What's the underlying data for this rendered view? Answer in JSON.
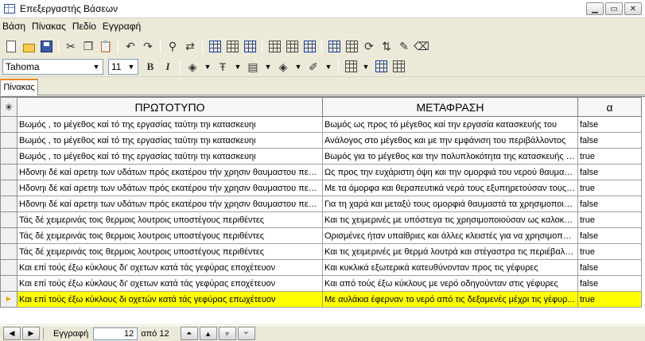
{
  "window": {
    "title": "Επεξεργαστής Βάσεων"
  },
  "menu": [
    "Βάση",
    "Πίνακας",
    "Πεδίο",
    "Εγγραφή"
  ],
  "format_toolbar": {
    "font": "Tahoma",
    "size": "11",
    "bold": "B",
    "italic": "I"
  },
  "tabs": [
    {
      "label": "Πίνακας",
      "active": true
    }
  ],
  "grid": {
    "columns": [
      "ΠΡΩΤΟΤΥΠΟ",
      "ΜΕΤΑΦΡΑΣΗ",
      "α"
    ],
    "header_marker": "✳",
    "current_marker": "►",
    "rows": [
      [
        "Βωμός , το μέγεθος καί τό της εργασίας ταύτηι τηι κατασκευηι",
        "Βωμός ως προς τό μέγεθος καί την εργασία κατασκευής του",
        "false"
      ],
      [
        "Βωμός , το μέγεθος καί τό της εργασίας ταύτηι τηι κατασκευηι",
        "Ανάλογος στο μέγεθος και με την εμφάνιση του περιβάλλοντος",
        "false"
      ],
      [
        "Βωμός , το μέγεθος καί τό της εργασίας ταύτηι τηι κατασκευηι",
        "Βωμός για το μέγεθος και την πολυπλοκότητα της κατασκευής του",
        "true"
      ],
      [
        "Ηδονηι δέ καί αρετηι των υδάτων πρός εκατέρου τήν χρησιν θαυμαστου πεφ...",
        "Ως προς την ευχάριστη όψη και την ομορφιά του νερού θαυμαζό...",
        "false"
      ],
      [
        "Ηδονηι δέ καί αρετηι των υδάτων πρός εκατέρου τήν χρησιν θαυμαστου πεφ...",
        "Με τα όμορφα και θεραπευτικά νερά τους εξυπηρετούσαν τους ...",
        "true"
      ],
      [
        "Ηδονηι δέ καί αρετηι των υδάτων πρός εκατέρου τήν χρησιν θαυμαστου πεφ...",
        "Για τη χαρά και μεταξύ τους ομορφιά θαυμαστά τα χρησιμοποιού...",
        "false"
      ],
      [
        "Τάς δέ χειμερινάς τοις θερμοις λουτροις υποστέγους περιθέντες",
        "Και τις χειμερινές με υπόστεγα τις χρησιμοποιούσαν ως καλοκαιρι...",
        "true"
      ],
      [
        "Τάς δέ χειμερινάς τοις θερμοις λουτροις υποστέγους περιθέντες",
        "Ορισμένες ήταν υπαίθριες και άλλες κλειστές για να χρησιμοποιο...",
        "false"
      ],
      [
        "Τάς δέ χειμερινάς τοις θερμοις λουτροις υποστέγους περιθέντες",
        "Και τις χειμερινές με θερμά λουτρά και στέγαστρα τις περιέβαλλαν",
        "true"
      ],
      [
        "Και επί τούς έξω κύκλους δι' οχετων κατά τάς γεφύρας εποχέτευον",
        "Και κυκλικά εξωτερικά κατευθύνονταν προς τις γέφυρες",
        "false"
      ],
      [
        "Και επί τούς έξω κύκλους δι' οχετων κατά τάς γεφύρας εποχέτευον",
        "Και από τούς έξω κύκλους με νερό οδηγούνταν στις γέφυρες",
        "false"
      ],
      [
        "Και επί τούς έξω κύκλους δι οχετών κατά τάς γεφύρας επωχέτευον",
        "Με αυλάκια έφερναν το νερό από τις δεξαμενές μέχρι τις γέφυρ...",
        "true"
      ]
    ],
    "current_row_index": 11
  },
  "navigator": {
    "label": "Εγγραφή",
    "record": "12",
    "of_text": "από 12"
  },
  "colors": {
    "current_row": "#ffff00",
    "tab_accent": "#e68b2c",
    "chrome": "#ece9d8"
  }
}
